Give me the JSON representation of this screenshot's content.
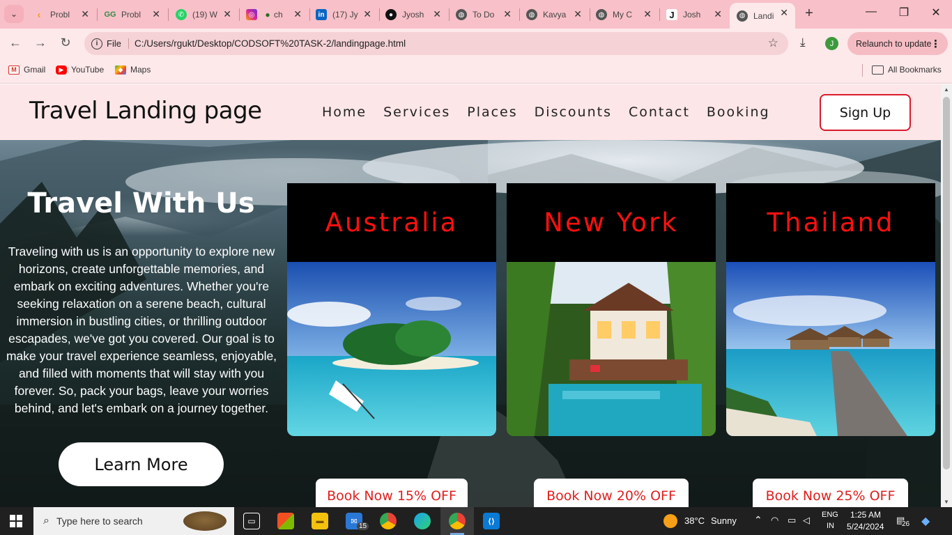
{
  "browser": {
    "tabs": [
      {
        "title": "Probl",
        "favicon": "leetcode-icon",
        "color": "#f0a020"
      },
      {
        "title": "Probl",
        "favicon": "geeksforgeeks-icon",
        "color": "#2f8d46"
      },
      {
        "title": "(19) W",
        "favicon": "whatsapp-icon",
        "color": "#25d366"
      },
      {
        "title": "ch",
        "favicon": "instagram-icon",
        "color": "#d6249f"
      },
      {
        "title": "(17) Jy",
        "favicon": "linkedin-icon",
        "color": "#0a66c2"
      },
      {
        "title": "Jyosh",
        "favicon": "github-icon",
        "color": "#111111"
      },
      {
        "title": "To Do",
        "favicon": "globe-icon",
        "color": "#555555"
      },
      {
        "title": "Kavya",
        "favicon": "globe-icon",
        "color": "#555555"
      },
      {
        "title": "My C",
        "favicon": "globe-icon",
        "color": "#555555"
      },
      {
        "title": "Josh",
        "favicon": "j-icon",
        "color": "#111111"
      },
      {
        "title": "Landi",
        "favicon": "globe-icon",
        "color": "#555555",
        "active": true
      }
    ],
    "address": {
      "scheme_label": "File",
      "url": "C:/Users/rgukt/Desktop/CODSOFT%20TASK-2/landingpage.html"
    },
    "profile_initial": "J",
    "relaunch_label": "Relaunch to update",
    "bookmarks": [
      {
        "label": "Gmail",
        "icon": "gmail-icon"
      },
      {
        "label": "YouTube",
        "icon": "youtube-icon"
      },
      {
        "label": "Maps",
        "icon": "maps-icon"
      }
    ],
    "all_bookmarks_label": "All Bookmarks"
  },
  "site": {
    "brand": "Travel Landing page",
    "nav": [
      "Home",
      "Services",
      "Places",
      "Discounts",
      "Contact",
      "Booking"
    ],
    "signup_label": "Sign Up",
    "accent": "#ff1010",
    "hero": {
      "title": "Travel With Us",
      "text": "Traveling with us is an opportunity to explore new horizons, create unforgettable memories, and embark on exciting adventures. Whether you're seeking relaxation on a serene beach, cultural immersion in bustling cities, or thrilling outdoor escapades, we've got you covered. Our goal is to make your travel experience seamless, enjoyable, and filled with moments that will stay with you forever. So, pack your bags, leave your worries behind, and let's embark on a journey together.",
      "cta_label": "Learn More"
    },
    "destinations": [
      {
        "name": "Australia",
        "book_label": "Book Now 15% OFF"
      },
      {
        "name": "New York",
        "book_label": "Book Now 20% OFF"
      },
      {
        "name": "Thailand",
        "book_label": "Book Now 25% OFF"
      }
    ]
  },
  "taskbar": {
    "search_placeholder": "Type here to search",
    "mail_badge": "15",
    "weather": {
      "temp": "38°C",
      "condition": "Sunny"
    },
    "lang": {
      "line1": "ENG",
      "line2": "IN"
    },
    "clock": {
      "time": "1:25 AM",
      "date": "5/24/2024"
    },
    "notifications": "26"
  }
}
